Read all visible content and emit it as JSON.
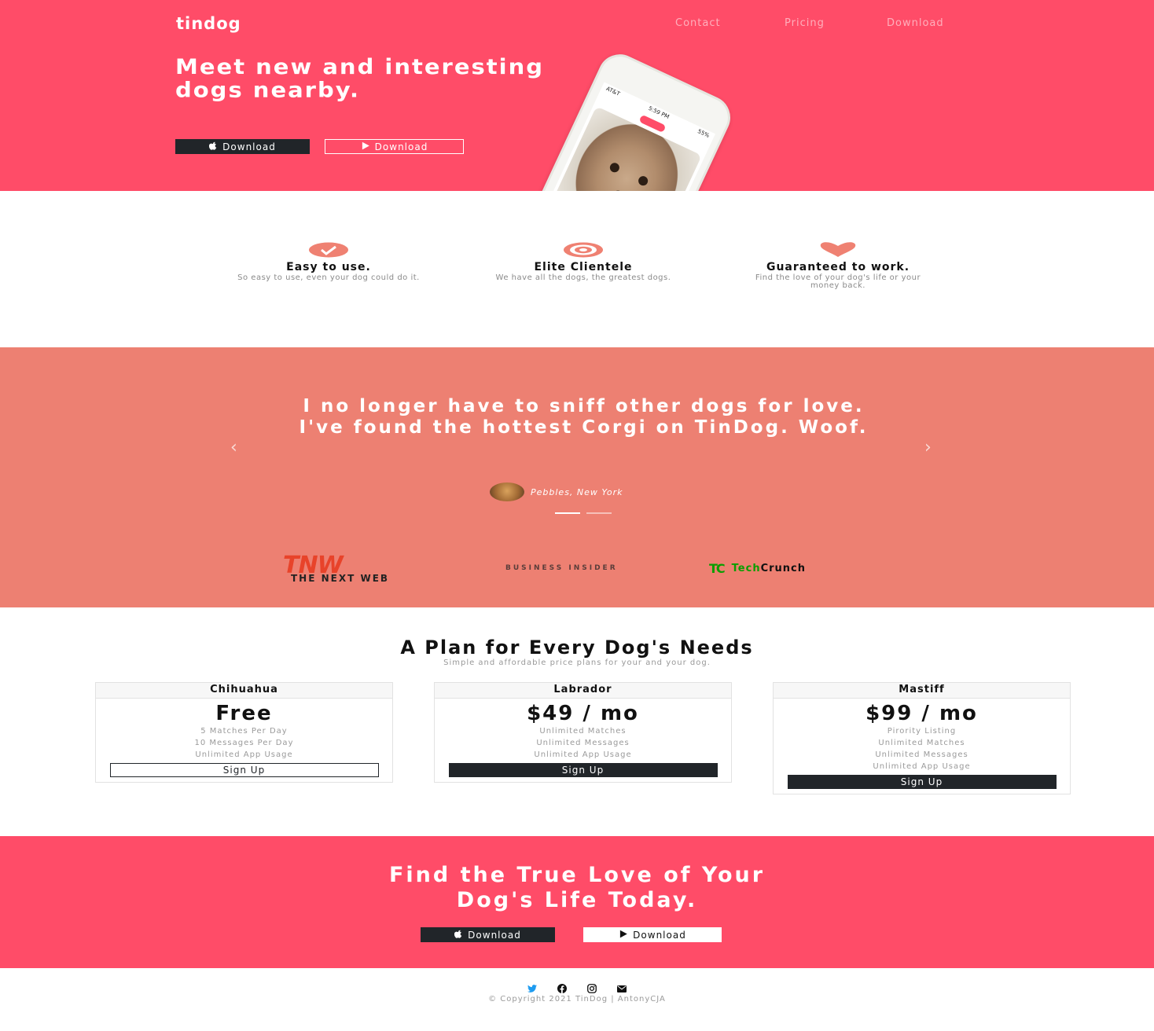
{
  "brand": "tindog",
  "nav": [
    "Contact",
    "Pricing",
    "Download"
  ],
  "hero": {
    "title": "Meet new and interesting dogs nearby.",
    "buttons": [
      {
        "label": "Download",
        "icon": "apple-icon"
      },
      {
        "label": "Download",
        "icon": "google-play-icon"
      }
    ],
    "phone": {
      "carrier": "AT&T",
      "time": "5:59 PM",
      "battery": "55%"
    }
  },
  "features": [
    {
      "icon": "check-circle-icon",
      "title": "Easy to use.",
      "text": "So easy to use, even your dog could do it."
    },
    {
      "icon": "bullseye-icon",
      "title": "Elite Clientele",
      "text": "We have all the dogs, the greatest dogs."
    },
    {
      "icon": "heart-icon",
      "title": "Guaranteed to work.",
      "text": "Find the love of your dog's life or your money back."
    }
  ],
  "testimonial": {
    "quote": "I no longer have to sniff other dogs for love. I've found the hottest Corgi on TinDog. Woof.",
    "author": "Pebbles, New York"
  },
  "press": {
    "tnw": {
      "mark": "TNW",
      "name": "THE NEXT WEB"
    },
    "business_insider": "BUSINESS INSIDER",
    "techcrunch": {
      "mark": "TC",
      "name_part1": "Tech",
      "name_part2": "Crunch"
    }
  },
  "pricing": {
    "title": "A Plan for Every Dog's Needs",
    "subtitle": "Simple and affordable price plans for your and your dog.",
    "plans": [
      {
        "name": "Chihuahua",
        "price": "Free",
        "features": [
          "5 Matches Per Day",
          "10 Messages Per Day",
          "Unlimited App Usage"
        ],
        "button": "Sign Up"
      },
      {
        "name": "Labrador",
        "price": "$49 / mo",
        "features": [
          "Unlimited Matches",
          "Unlimited Messages",
          "Unlimited App Usage"
        ],
        "button": "Sign Up"
      },
      {
        "name": "Mastiff",
        "price": "$99 / mo",
        "features": [
          "Pirority Listing",
          "Unlimited Matches",
          "Unlimited Messages",
          "Unlimited App Usage"
        ],
        "button": "Sign Up"
      }
    ]
  },
  "cta": {
    "title": "Find the True Love of Your Dog's Life Today.",
    "buttons": [
      {
        "label": "Download",
        "icon": "apple-icon"
      },
      {
        "label": "Download",
        "icon": "google-play-icon"
      }
    ]
  },
  "footer": {
    "socials": [
      "twitter-icon",
      "facebook-icon",
      "instagram-icon",
      "envelope-icon"
    ],
    "copyright": "© Copyright 2021 TinDog | AntonyCJA"
  },
  "colors": {
    "primary": "#ff4c68",
    "testimonial_bg": "#ed8072",
    "dark": "#212529",
    "accent_icon": "#ef8172",
    "techcrunch_green": "#0a9e01"
  }
}
